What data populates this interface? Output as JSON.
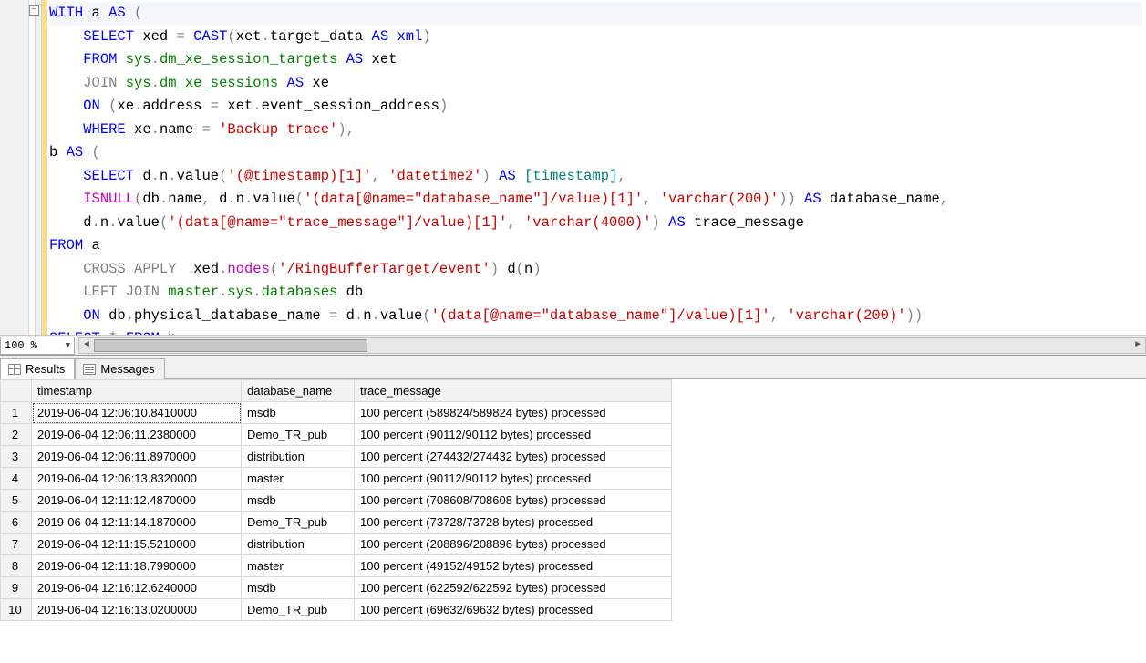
{
  "editor": {
    "zoom": "100 %",
    "collapse_glyph": "−",
    "lines": [
      {
        "hl": true,
        "indent": 0,
        "tokens": [
          [
            "kw",
            "WITH"
          ],
          [
            "ident",
            " a "
          ],
          [
            "kw",
            "AS"
          ],
          [
            "gray",
            " ("
          ]
        ]
      },
      {
        "indent": 1,
        "tokens": [
          [
            "kw",
            "SELECT"
          ],
          [
            "ident",
            " xed "
          ],
          [
            "gray",
            "="
          ],
          [
            "ident",
            " "
          ],
          [
            "kw",
            "CAST"
          ],
          [
            "gray",
            "("
          ],
          [
            "ident",
            "xet"
          ],
          [
            "gray",
            "."
          ],
          [
            "ident",
            "target_data "
          ],
          [
            "kw",
            "AS"
          ],
          [
            "ident",
            " "
          ],
          [
            "kw",
            "xml"
          ],
          [
            "gray",
            ")"
          ]
        ]
      },
      {
        "indent": 1,
        "tokens": [
          [
            "kw",
            "FROM"
          ],
          [
            "ident",
            " "
          ],
          [
            "sys",
            "sys"
          ],
          [
            "gray",
            "."
          ],
          [
            "sys",
            "dm_xe_session_targets"
          ],
          [
            "ident",
            " "
          ],
          [
            "kw",
            "AS"
          ],
          [
            "ident",
            " xet"
          ]
        ]
      },
      {
        "indent": 1,
        "tokens": [
          [
            "gray",
            "JOIN"
          ],
          [
            "ident",
            " "
          ],
          [
            "sys",
            "sys"
          ],
          [
            "gray",
            "."
          ],
          [
            "sys",
            "dm_xe_sessions"
          ],
          [
            "ident",
            " "
          ],
          [
            "kw",
            "AS"
          ],
          [
            "ident",
            " xe"
          ]
        ]
      },
      {
        "indent": 1,
        "tokens": [
          [
            "kw",
            "ON"
          ],
          [
            "ident",
            " "
          ],
          [
            "gray",
            "("
          ],
          [
            "ident",
            "xe"
          ],
          [
            "gray",
            "."
          ],
          [
            "ident",
            "address "
          ],
          [
            "gray",
            "="
          ],
          [
            "ident",
            " xet"
          ],
          [
            "gray",
            "."
          ],
          [
            "ident",
            "event_session_address"
          ],
          [
            "gray",
            ")"
          ]
        ]
      },
      {
        "indent": 1,
        "tokens": [
          [
            "kw",
            "WHERE"
          ],
          [
            "ident",
            " xe"
          ],
          [
            "gray",
            "."
          ],
          [
            "ident",
            "name "
          ],
          [
            "gray",
            "="
          ],
          [
            "ident",
            " "
          ],
          [
            "str",
            "'Backup trace'"
          ],
          [
            "gray",
            ")"
          ],
          [
            "gray",
            ","
          ]
        ]
      },
      {
        "indent": 0,
        "tokens": [
          [
            "ident",
            "b "
          ],
          [
            "kw",
            "AS"
          ],
          [
            "gray",
            " ("
          ]
        ]
      },
      {
        "indent": 1,
        "tokens": [
          [
            "kw",
            "SELECT"
          ],
          [
            "ident",
            " d"
          ],
          [
            "gray",
            "."
          ],
          [
            "ident",
            "n"
          ],
          [
            "gray",
            "."
          ],
          [
            "ident",
            "value"
          ],
          [
            "gray",
            "("
          ],
          [
            "str",
            "'(@timestamp)[1]'"
          ],
          [
            "gray",
            ","
          ],
          [
            "ident",
            " "
          ],
          [
            "str",
            "'datetime2'"
          ],
          [
            "gray",
            ")"
          ],
          [
            "ident",
            " "
          ],
          [
            "kw",
            "AS"
          ],
          [
            "ident",
            " "
          ],
          [
            "teal",
            "["
          ],
          [
            "teal",
            "timestamp"
          ],
          [
            "teal",
            "]"
          ],
          [
            "gray",
            ","
          ]
        ]
      },
      {
        "indent": 1,
        "tokens": [
          [
            "fn",
            "ISNULL"
          ],
          [
            "gray",
            "("
          ],
          [
            "ident",
            "db"
          ],
          [
            "gray",
            "."
          ],
          [
            "ident",
            "name"
          ],
          [
            "gray",
            ","
          ],
          [
            "ident",
            " d"
          ],
          [
            "gray",
            "."
          ],
          [
            "ident",
            "n"
          ],
          [
            "gray",
            "."
          ],
          [
            "ident",
            "value"
          ],
          [
            "gray",
            "("
          ],
          [
            "str",
            "'(data[@name=\"database_name\"]/value)[1]'"
          ],
          [
            "gray",
            ","
          ],
          [
            "ident",
            " "
          ],
          [
            "str",
            "'varchar(200)'"
          ],
          [
            "gray",
            "))"
          ],
          [
            "ident",
            " "
          ],
          [
            "kw",
            "AS"
          ],
          [
            "ident",
            " database_name"
          ],
          [
            "gray",
            ","
          ]
        ]
      },
      {
        "indent": 1,
        "tokens": [
          [
            "ident",
            "d"
          ],
          [
            "gray",
            "."
          ],
          [
            "ident",
            "n"
          ],
          [
            "gray",
            "."
          ],
          [
            "ident",
            "value"
          ],
          [
            "gray",
            "("
          ],
          [
            "str",
            "'(data[@name=\"trace_message\"]/value)[1]'"
          ],
          [
            "gray",
            ","
          ],
          [
            "ident",
            " "
          ],
          [
            "str",
            "'varchar(4000)'"
          ],
          [
            "gray",
            ")"
          ],
          [
            "ident",
            " "
          ],
          [
            "kw",
            "AS"
          ],
          [
            "ident",
            " trace_message"
          ]
        ]
      },
      {
        "indent": 0,
        "tokens": [
          [
            "kw",
            "FROM"
          ],
          [
            "ident",
            " a"
          ]
        ]
      },
      {
        "indent": 1,
        "tokens": [
          [
            "gray",
            "CROSS APPLY"
          ],
          [
            "ident",
            "  xed"
          ],
          [
            "gray",
            "."
          ],
          [
            "fn",
            "nodes"
          ],
          [
            "gray",
            "("
          ],
          [
            "str",
            "'/RingBufferTarget/event'"
          ],
          [
            "gray",
            ")"
          ],
          [
            "ident",
            " d"
          ],
          [
            "gray",
            "("
          ],
          [
            "ident",
            "n"
          ],
          [
            "gray",
            ")"
          ]
        ]
      },
      {
        "indent": 1,
        "tokens": [
          [
            "gray",
            "LEFT JOIN"
          ],
          [
            "ident",
            " "
          ],
          [
            "sys",
            "master"
          ],
          [
            "gray",
            "."
          ],
          [
            "sys",
            "sys"
          ],
          [
            "gray",
            "."
          ],
          [
            "sys",
            "databases"
          ],
          [
            "ident",
            " db"
          ]
        ]
      },
      {
        "indent": 1,
        "tokens": [
          [
            "kw",
            "ON"
          ],
          [
            "ident",
            " db"
          ],
          [
            "gray",
            "."
          ],
          [
            "ident",
            "physical_database_name "
          ],
          [
            "gray",
            "="
          ],
          [
            "ident",
            " d"
          ],
          [
            "gray",
            "."
          ],
          [
            "ident",
            "n"
          ],
          [
            "gray",
            "."
          ],
          [
            "ident",
            "value"
          ],
          [
            "gray",
            "("
          ],
          [
            "str",
            "'(data[@name=\"database_name\"]/value)[1]'"
          ],
          [
            "gray",
            ","
          ],
          [
            "ident",
            " "
          ],
          [
            "str",
            "'varchar(200)'"
          ],
          [
            "gray",
            "))"
          ]
        ]
      },
      {
        "indent": 0,
        "tokens": [
          [
            "kw",
            "SELECT"
          ],
          [
            "ident",
            " "
          ],
          [
            "gray",
            "*"
          ],
          [
            "ident",
            " "
          ],
          [
            "kw",
            "FROM"
          ],
          [
            "ident",
            " b"
          ]
        ]
      }
    ]
  },
  "tabs": {
    "results": "Results",
    "messages": "Messages"
  },
  "results": {
    "columns": [
      "timestamp",
      "database_name",
      "trace_message"
    ],
    "rows": [
      [
        "2019-06-04 12:06:10.8410000",
        "msdb",
        "100 percent (589824/589824 bytes) processed"
      ],
      [
        "2019-06-04 12:06:11.2380000",
        "Demo_TR_pub",
        "100 percent (90112/90112 bytes) processed"
      ],
      [
        "2019-06-04 12:06:11.8970000",
        "distribution",
        "100 percent (274432/274432 bytes) processed"
      ],
      [
        "2019-06-04 12:06:13.8320000",
        "master",
        "100 percent (90112/90112 bytes) processed"
      ],
      [
        "2019-06-04 12:11:12.4870000",
        "msdb",
        "100 percent (708608/708608 bytes) processed"
      ],
      [
        "2019-06-04 12:11:14.1870000",
        "Demo_TR_pub",
        "100 percent (73728/73728 bytes) processed"
      ],
      [
        "2019-06-04 12:11:15.5210000",
        "distribution",
        "100 percent (208896/208896 bytes) processed"
      ],
      [
        "2019-06-04 12:11:18.7990000",
        "master",
        "100 percent (49152/49152 bytes) processed"
      ],
      [
        "2019-06-04 12:16:12.6240000",
        "msdb",
        "100 percent (622592/622592 bytes) processed"
      ],
      [
        "2019-06-04 12:16:13.0200000",
        "Demo_TR_pub",
        "100 percent (69632/69632 bytes) processed"
      ]
    ]
  }
}
